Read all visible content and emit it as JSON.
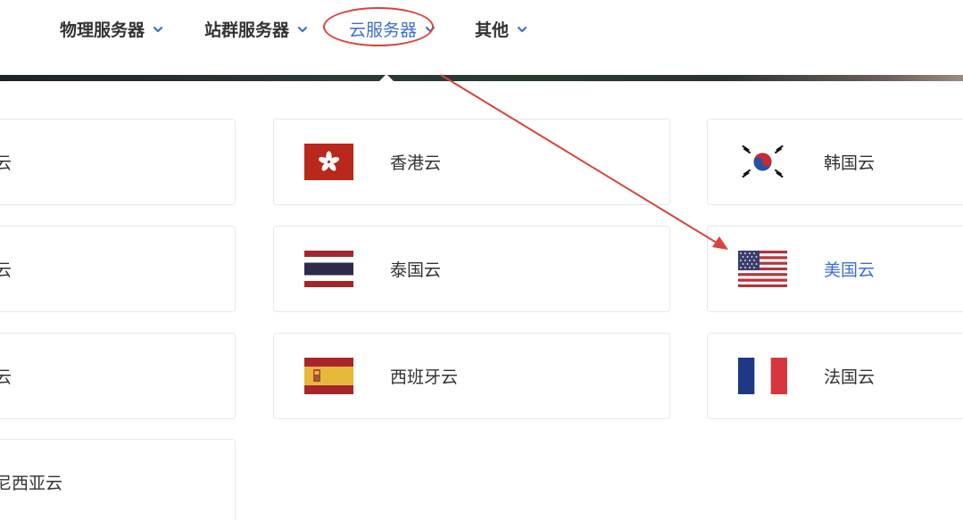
{
  "nav": {
    "items": [
      {
        "label": "物理服务器"
      },
      {
        "label": "站群服务器"
      },
      {
        "label": "云服务器"
      },
      {
        "label": "其他"
      }
    ]
  },
  "cards": {
    "left": [
      "云",
      "云",
      "云",
      "尼西亚云"
    ],
    "middle": [
      "香港云",
      "泰国云",
      "西班牙云"
    ],
    "right": [
      "韩国云",
      "美国云",
      "法国云"
    ]
  },
  "colors": {
    "accent": "#3d6fd6",
    "annotation": "#d9433b"
  },
  "icons": [
    "chevron-down-icon",
    "hong-kong-flag-icon",
    "thailand-flag-icon",
    "spain-flag-icon",
    "korea-flag-icon",
    "usa-flag-icon",
    "france-flag-icon"
  ]
}
